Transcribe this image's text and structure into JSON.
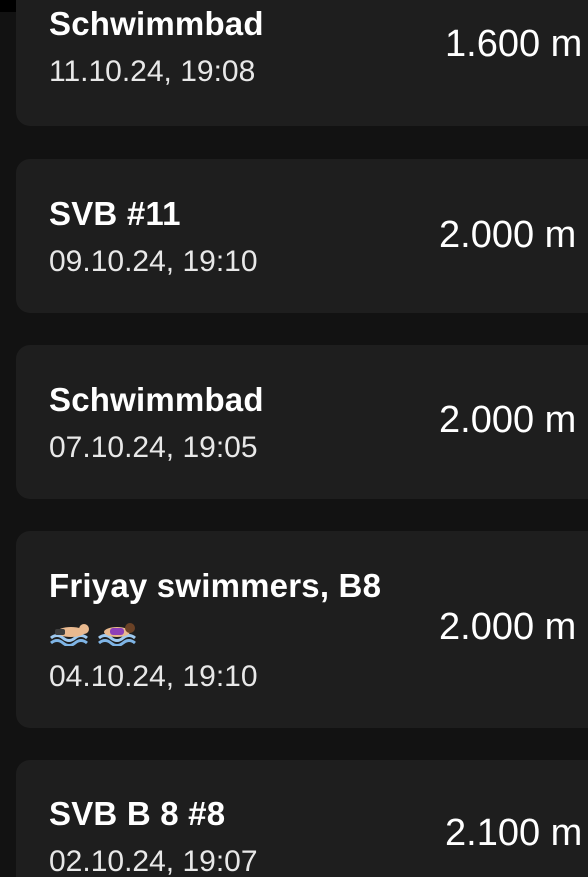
{
  "workouts": [
    {
      "title": "Schwimmbad",
      "date": "11.10.24, 19:08",
      "distance": "1.600 m"
    },
    {
      "title": "SVB #11",
      "date": "09.10.24, 19:10",
      "distance": "2.000 m"
    },
    {
      "title": "Schwimmbad",
      "date": "07.10.24, 19:05",
      "distance": "2.000 m"
    },
    {
      "title": "Friyay swimmers, B8",
      "title_emojis": [
        "man-swimming-icon",
        "woman-swimming-icon"
      ],
      "date": "04.10.24, 19:10",
      "distance": "2.000 m"
    },
    {
      "title": "SVB B 8 #8",
      "date": "02.10.24, 19:07",
      "distance": "2.100 m"
    }
  ],
  "colors": {
    "background": "#121212",
    "card": "#1e1e1e",
    "text": "#ffffff"
  }
}
